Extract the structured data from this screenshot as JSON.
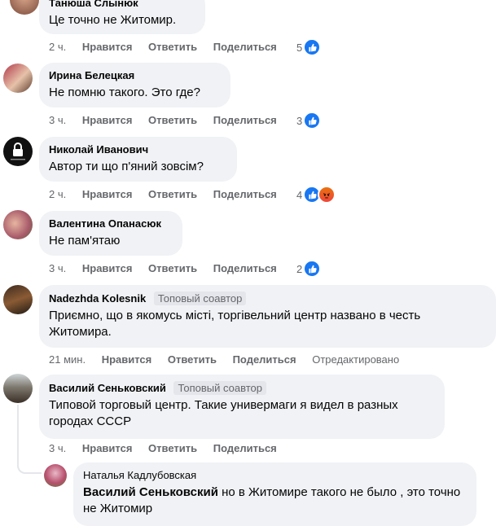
{
  "comments": [
    {
      "author": "Танюша Слынюк",
      "text": "Це точно не Житомир.",
      "time": "2 ч.",
      "like": "Нравится",
      "reply": "Ответить",
      "share": "Поделиться",
      "reaction_count": "5",
      "reactions": [
        "like-icon"
      ]
    },
    {
      "author": "Ирина Белецкая",
      "text": "Не помню такого. Это где?",
      "time": "3 ч.",
      "like": "Нравится",
      "reply": "Ответить",
      "share": "Поделиться",
      "reaction_count": "3",
      "reactions": [
        "like-icon"
      ]
    },
    {
      "author": "Николай Иванович",
      "text": "Автор ти що п'яний зовсім?",
      "time": "2 ч.",
      "like": "Нравится",
      "reply": "Ответить",
      "share": "Поделиться",
      "reaction_count": "4",
      "reactions": [
        "like-icon",
        "angry-icon"
      ]
    },
    {
      "author": "Валентина Опанасюк",
      "text": "Не пам'ятаю",
      "time": "3 ч.",
      "like": "Нравится",
      "reply": "Ответить",
      "share": "Поделиться",
      "reaction_count": "2",
      "reactions": [
        "like-icon"
      ]
    },
    {
      "author": "Nadezhda Kolesnik",
      "badge": "Топовый соавтор",
      "text": "Приємно, що в якомусь місті, торгівельний центр названо в честь Житомира.",
      "time": "21 мин.",
      "like": "Нравится",
      "reply": "Ответить",
      "share": "Поделиться",
      "edited": "Отредактировано"
    },
    {
      "author": "Василий Сеньковский",
      "badge": "Топовый соавтор",
      "text": "Типовой торговый центр. Такие универмаги я видел в разных городах СССР",
      "time": "3 ч.",
      "like": "Нравится",
      "reply": "Ответить",
      "share": "Поделиться"
    }
  ],
  "reply": {
    "author": "Наталья Кадлубовская",
    "mention": "Василий Сеньковский",
    "text": " но в Житомире такого не было , это точно не Житомир"
  },
  "colors": {
    "bubble": "#f0f2f5",
    "meta": "#65676b",
    "like": "#1877f2"
  }
}
